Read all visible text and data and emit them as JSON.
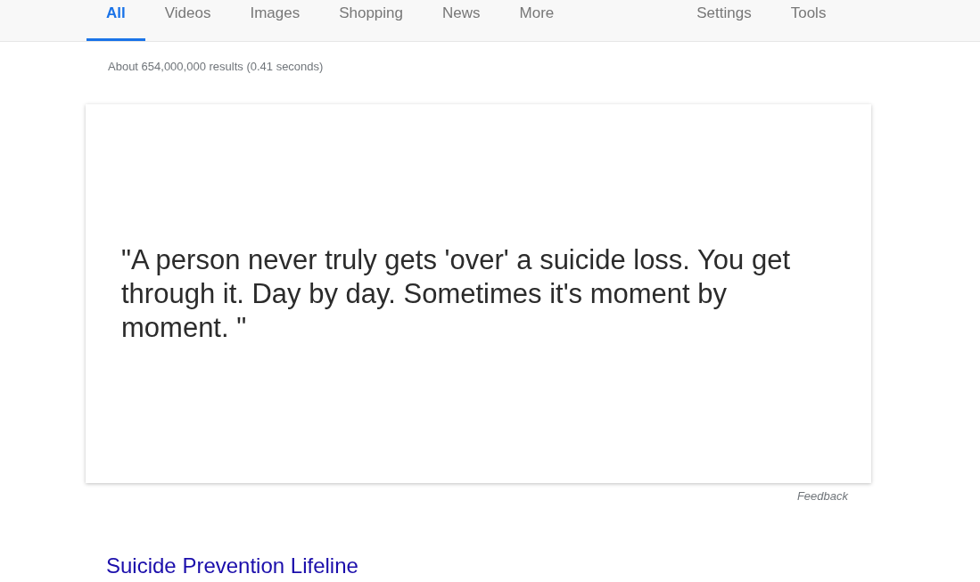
{
  "tabs": [
    {
      "label": "All",
      "selected": true
    },
    {
      "label": "Videos",
      "selected": false
    },
    {
      "label": "Images",
      "selected": false
    },
    {
      "label": "Shopping",
      "selected": false
    },
    {
      "label": "News",
      "selected": false
    },
    {
      "label": "More",
      "selected": false
    }
  ],
  "tool_links": [
    {
      "label": "Settings"
    },
    {
      "label": "Tools"
    }
  ],
  "result_stats": "About 654,000,000 results (0.41 seconds)",
  "featured_card": {
    "quote": "\"A person never truly gets 'over' a suicide loss. You get through it. Day by day. Sometimes it's moment by moment. \""
  },
  "feedback": "Feedback",
  "result": {
    "title": "Suicide Prevention Lifeline"
  }
}
